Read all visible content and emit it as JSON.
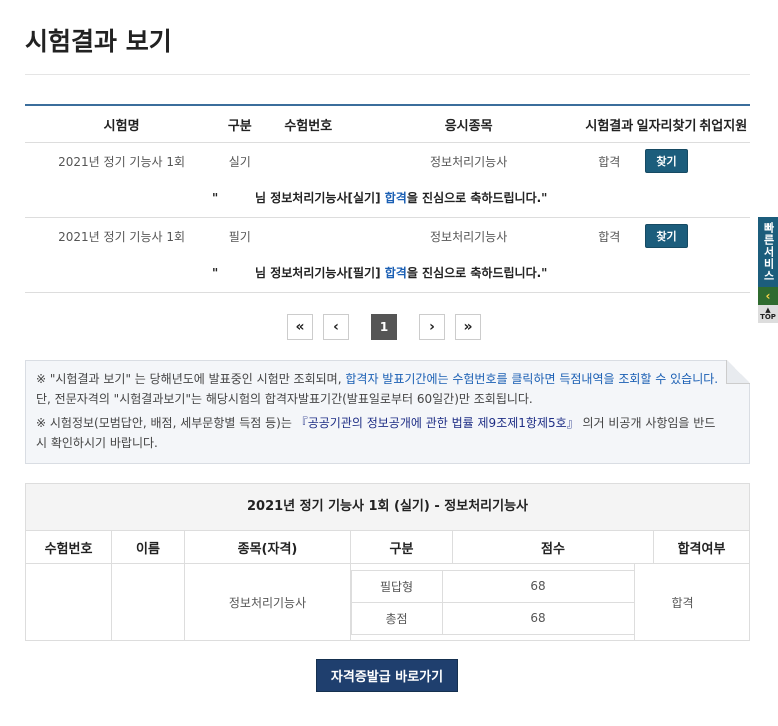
{
  "page_title": "시험결과 보기",
  "results_table": {
    "headers": [
      "시험명",
      "구분",
      "수험번호",
      "응시종목",
      "시험결과",
      "일자리찾기",
      "취업지원"
    ],
    "rows": [
      {
        "exam": "2021년 정기 기능사 1회",
        "type": "실기",
        "number": "",
        "subject": "정보처리기능사",
        "result": "합격",
        "button": "찾기",
        "msg_quote": "\"",
        "msg_pre": "님 정보처리기능사[실기] ",
        "msg_hl": "합격",
        "msg_post": "을 진심으로 축하드립니다.\""
      },
      {
        "exam": "2021년 정기 기능사 1회",
        "type": "필기",
        "number": "",
        "subject": "정보처리기능사",
        "result": "합격",
        "button": "찾기",
        "msg_quote": "\"",
        "msg_pre": "님 정보처리기능사[필기] ",
        "msg_hl": "합격",
        "msg_post": "을 진심으로 축하드립니다.\""
      }
    ]
  },
  "pagination": {
    "first": "«",
    "prev": "‹",
    "current": "1",
    "next": "›",
    "last": "»"
  },
  "notice": {
    "line1_a": "※ \"시험결과 보기\" 는 당해년도에 발표중인 시험만 조회되며, ",
    "line1_b": "합격자 발표기간에는 수험번호를 클릭하면 득점내역을 조회할 수 있습니다.",
    "line1_c": " 단, 전문자격의 \"시험결과보기\"는 해당시험의 합격자발표기간(발표일로부터 60일간)만 조회됩니다.",
    "line2_a": "※ 시험정보(모범답안, 배점, 세부문항별 득점 등)는 ",
    "line2_b": "『공공기관의 정보공개에 관한 법률 제9조제1항제5호』",
    "line2_c": " 의거 비공개 사항임을 반드시 확인하시기 바랍니다."
  },
  "detail": {
    "title": "2021년 정기 기능사 1회 (실기) - 정보처리기능사",
    "headers": [
      "수험번호",
      "이름",
      "종목(자격)",
      "구분",
      "점수",
      "합격여부"
    ],
    "number": "",
    "name": "",
    "subject": "정보처리기능사",
    "scores": [
      {
        "label": "필답형",
        "score": "68"
      },
      {
        "label": "총점",
        "score": "68"
      }
    ],
    "result": "합격"
  },
  "issue_button": "자격증발급 바로가기",
  "quick_menu": {
    "label": "빠른서비스",
    "arrow": "‹",
    "top": "TOP"
  }
}
